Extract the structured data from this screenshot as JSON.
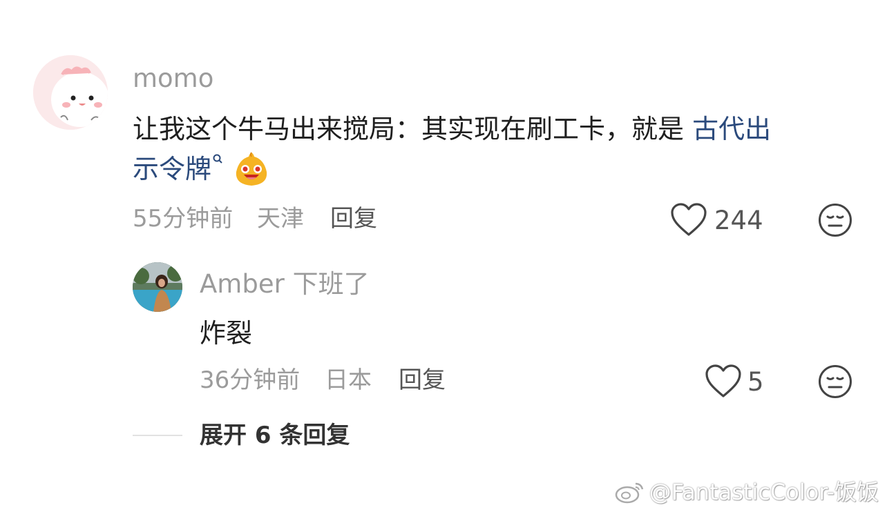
{
  "comment": {
    "username": "momo",
    "text_plain": "让我这个牛马出来搅局：其实现在刷工卡，就是",
    "text_link_line1": "古代出",
    "text_link_line2": "示令牌",
    "search_icon": "search-icon",
    "emoji": "smiling-drool-emoji",
    "time": "55分钟前",
    "location": "天津",
    "reply_label": "回复",
    "like_count": "244",
    "avatar_icon": "cartoon-dinosaur-avatar"
  },
  "reply": {
    "username": "Amber 下班了",
    "text": "炸裂",
    "time": "36分钟前",
    "location": "日本",
    "reply_label": "回复",
    "like_count": "5",
    "avatar_icon": "pool-photo-avatar"
  },
  "expand_label": "展开 6 条回复",
  "watermark": "@FantasticColor-饭饭",
  "colors": {
    "link": "#2b4a7c",
    "meta": "#9b9b9b",
    "text": "#1f1f1f"
  }
}
